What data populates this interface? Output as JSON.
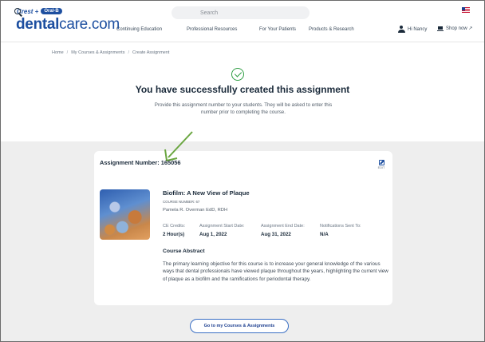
{
  "header": {
    "logo_crest": "Crest +",
    "logo_oralb": "Oral-B",
    "logo_bold": "dental",
    "logo_rest": "care.com",
    "search_placeholder": "Search",
    "nav": [
      "Continuing Education",
      "Professional Resources",
      "For Your Patients",
      "Products & Research"
    ],
    "user_label": "Hi Nancy",
    "shop_label": "Shop now ↗"
  },
  "breadcrumb": [
    "Home",
    "My Courses & Assignments",
    "Create Assignment"
  ],
  "success": {
    "title": "You have successfully created this assignment",
    "subtitle": "Provide this assignment number to your students. They will be asked to enter this number prior to completing the course."
  },
  "assignment": {
    "label": "Assignment Number: 165056",
    "edit_label": "EDIT"
  },
  "course": {
    "title": "Biofilm: A New View of Plaque",
    "number": "COURSE NUMBER: 67",
    "author": "Pamela R. Overman EdD, RDH",
    "meta": [
      {
        "label": "CE Credits:",
        "value": "2 Hour(s)"
      },
      {
        "label": "Assignment Start Date:",
        "value": "Aug 1, 2022"
      },
      {
        "label": "Assignment End Date:",
        "value": "Aug 31, 2022"
      },
      {
        "label": "Notifications Sent To:",
        "value": "N/A"
      }
    ],
    "abstract_heading": "Course Abstract",
    "abstract": "The primary learning objective for this course is to increase your general knowledge of the various ways that dental professionals have viewed plaque throughout the years, highlighting the current view of plaque as a biofilm and the ramifications for periodontal therapy."
  },
  "go_button": "Go to my Courses & Assignments",
  "colors": {
    "brand": "#1d4fa0",
    "success": "#2e9d43",
    "annotation_arrow": "#6aa640"
  },
  "icons": [
    "search-icon",
    "flag-icon",
    "user-icon",
    "cart-icon",
    "check-circle-icon",
    "edit-icon",
    "annotation-arrow"
  ]
}
